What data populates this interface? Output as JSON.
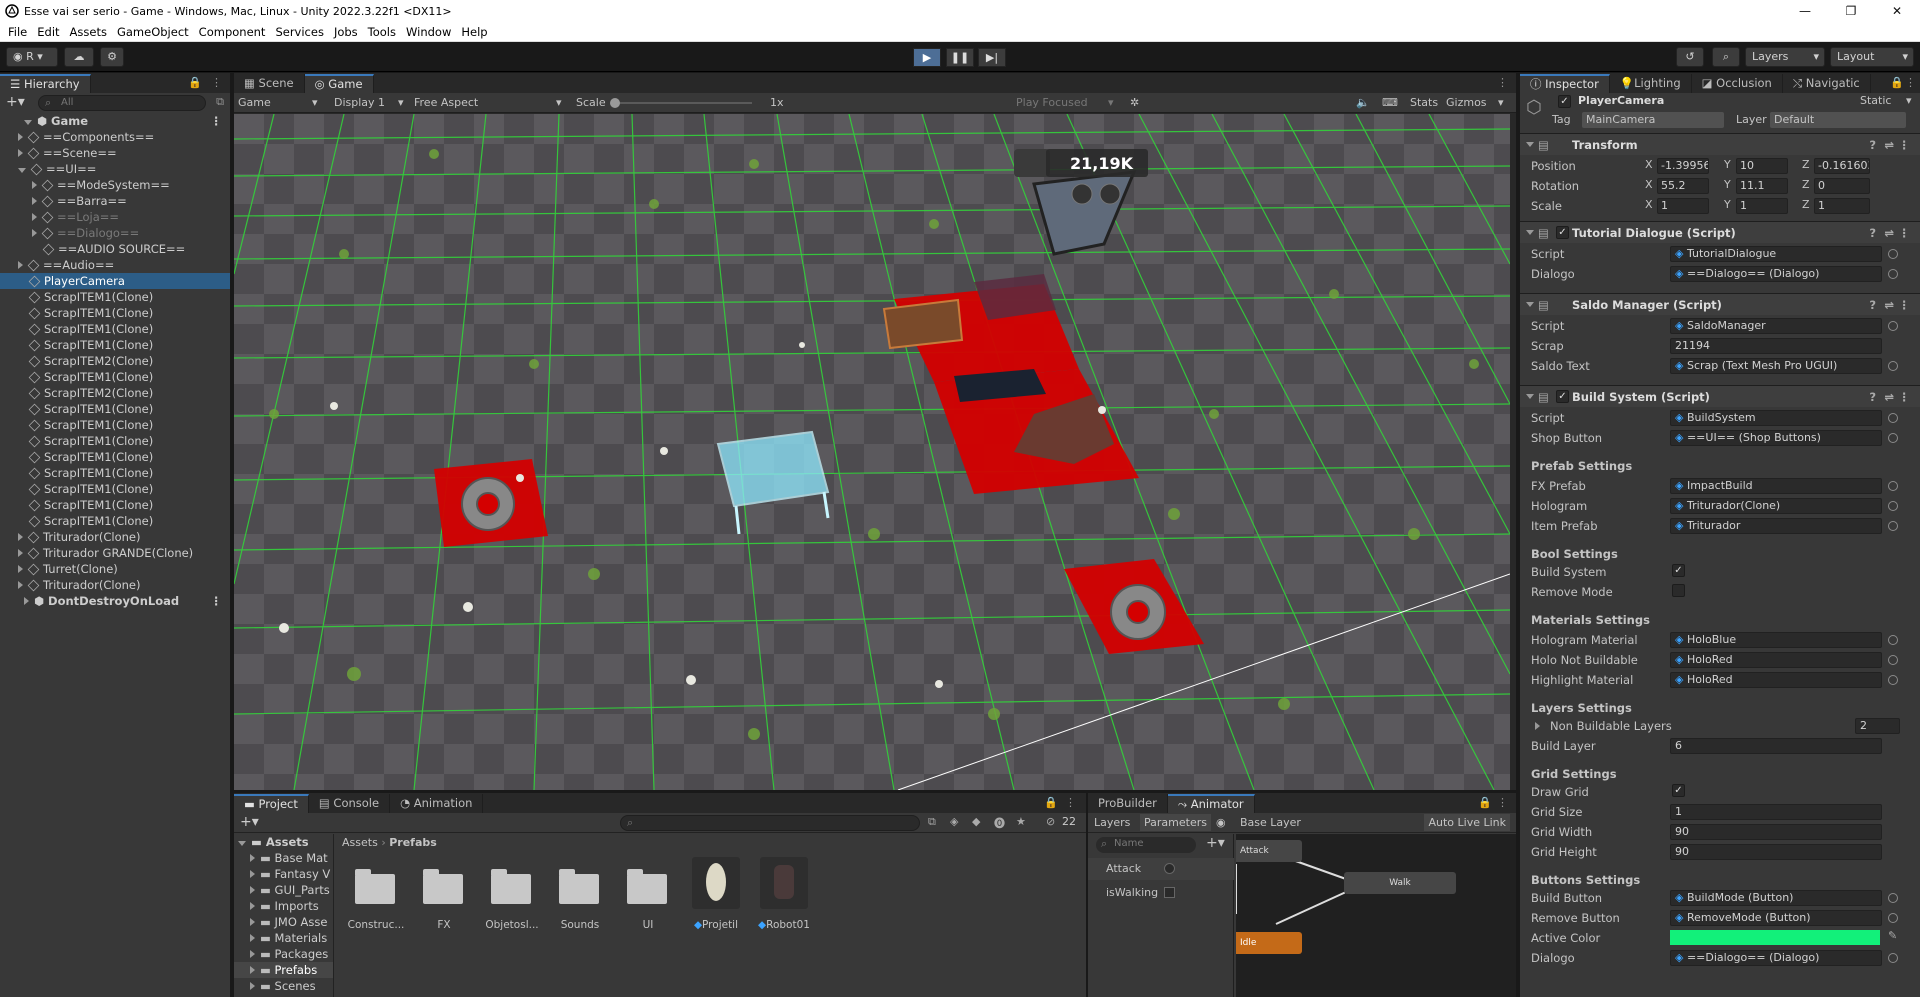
{
  "window": {
    "title": "Esse vai ser serio - Game - Windows, Mac, Linux - Unity 2022.3.22f1 <DX11>",
    "min": "—",
    "max": "❐",
    "close": "✕"
  },
  "menu": [
    "File",
    "Edit",
    "Assets",
    "GameObject",
    "Component",
    "Services",
    "Jobs",
    "Tools",
    "Window",
    "Help"
  ],
  "toolbar": {
    "account": "R",
    "layers": "Layers",
    "layout": "Layout"
  },
  "hierarchy": {
    "tab": "Hierarchy",
    "search_placeholder": "All",
    "items": [
      {
        "label": "Game",
        "depth": 0,
        "type": "scene",
        "expanded": true
      },
      {
        "label": "==Components==",
        "depth": 1,
        "arrow": true
      },
      {
        "label": "==Scene==",
        "depth": 1,
        "arrow": true
      },
      {
        "label": "==UI==",
        "depth": 1,
        "arrow": true,
        "expanded": true
      },
      {
        "label": "==ModeSystem==",
        "depth": 2,
        "arrow": true
      },
      {
        "label": "==Barra==",
        "depth": 2,
        "arrow": true
      },
      {
        "label": "==Loja==",
        "depth": 2,
        "arrow": true,
        "dim": true
      },
      {
        "label": "==Dialogo==",
        "depth": 2,
        "arrow": true,
        "dim": true
      },
      {
        "label": "==AUDIO SOURCE==",
        "depth": 2
      },
      {
        "label": "==Audio==",
        "depth": 1,
        "arrow": true
      },
      {
        "label": "PlayerCamera",
        "depth": 1,
        "selected": true
      },
      {
        "label": "ScrapITEM1(Clone)",
        "depth": 1
      },
      {
        "label": "ScrapITEM1(Clone)",
        "depth": 1
      },
      {
        "label": "ScrapITEM1(Clone)",
        "depth": 1
      },
      {
        "label": "ScrapITEM1(Clone)",
        "depth": 1
      },
      {
        "label": "ScrapITEM2(Clone)",
        "depth": 1
      },
      {
        "label": "ScrapITEM1(Clone)",
        "depth": 1
      },
      {
        "label": "ScrapITEM2(Clone)",
        "depth": 1
      },
      {
        "label": "ScrapITEM1(Clone)",
        "depth": 1
      },
      {
        "label": "ScrapITEM1(Clone)",
        "depth": 1
      },
      {
        "label": "ScrapITEM1(Clone)",
        "depth": 1
      },
      {
        "label": "ScrapITEM1(Clone)",
        "depth": 1
      },
      {
        "label": "ScrapITEM1(Clone)",
        "depth": 1
      },
      {
        "label": "ScrapITEM1(Clone)",
        "depth": 1
      },
      {
        "label": "ScrapITEM1(Clone)",
        "depth": 1
      },
      {
        "label": "ScrapITEM1(Clone)",
        "depth": 1
      },
      {
        "label": "Triturador(Clone)",
        "depth": 1,
        "arrow": true
      },
      {
        "label": "Triturador GRANDE(Clone)",
        "depth": 1,
        "arrow": true
      },
      {
        "label": "Turret(Clone)",
        "depth": 1,
        "arrow": true
      },
      {
        "label": "Triturador(Clone)",
        "depth": 1,
        "arrow": true
      },
      {
        "label": "DontDestroyOnLoad",
        "depth": 0,
        "type": "scene",
        "arrow": true
      }
    ]
  },
  "scene_tabs": {
    "scene": "Scene",
    "game": "Game"
  },
  "game_bar": {
    "mode": "Game",
    "display": "Display 1",
    "aspect": "Free Aspect",
    "scale_label": "Scale",
    "scale_value": "1x",
    "play_focused": "Play Focused",
    "stats": "Stats",
    "gizmos": "Gizmos"
  },
  "hud": {
    "scrap": "21,19K"
  },
  "inspector": {
    "tabs": [
      "Inspector",
      "Lighting",
      "Occlusion",
      "Navigatic"
    ],
    "object_name": "PlayerCamera",
    "static": "Static",
    "tag_label": "Tag",
    "tag": "MainCamera",
    "layer_label": "Layer",
    "layer": "Default",
    "transform": {
      "title": "Transform",
      "rows": [
        {
          "label": "Position",
          "x": "-1.399563",
          "y": "10",
          "z": "-0.161603"
        },
        {
          "label": "Rotation",
          "x": "55.2",
          "y": "11.1",
          "z": "0"
        },
        {
          "label": "Scale",
          "x": "1",
          "y": "1",
          "z": "1"
        }
      ]
    },
    "tutorial": {
      "title": "Tutorial Dialogue (Script)",
      "script_label": "Script",
      "script": "TutorialDialogue",
      "dialogo_label": "Dialogo",
      "dialogo": "==Dialogo== (Dialogo)"
    },
    "saldo": {
      "title": "Saldo Manager (Script)",
      "script_label": "Script",
      "script": "SaldoManager",
      "scrap_label": "Scrap",
      "scrap": "21194",
      "text_label": "Saldo Text",
      "text": "Scrap (Text Mesh Pro UGUI)"
    },
    "build": {
      "title": "Build System (Script)",
      "script_label": "Script",
      "script": "BuildSystem",
      "shop_label": "Shop Button",
      "shop": "==UI== (Shop Buttons)",
      "prefab_title": "Prefab Settings",
      "fx_label": "FX Prefab",
      "fx": "ImpactBuild",
      "holo_label": "Hologram",
      "holo": "Triturador(Clone)",
      "item_label": "Item Prefab",
      "item": "Triturador",
      "bool_title": "Bool Settings",
      "buildsys_label": "Build System",
      "remove_label": "Remove Mode",
      "mat_title": "Materials Settings",
      "hm_label": "Hologram Material",
      "hm": "HoloBlue",
      "hnb_label": "Holo Not Buildable",
      "hnb": "HoloRed",
      "hl_label": "Highlight Material",
      "hl": "HoloRed",
      "layers_title": "Layers Settings",
      "nbl_label": "Non Buildable Layers",
      "nbl": "2",
      "bl_label": "Build Layer",
      "bl": "6",
      "grid_title": "Grid Settings",
      "draw_label": "Draw Grid",
      "size_label": "Grid Size",
      "size": "1",
      "width_label": "Grid Width",
      "width": "90",
      "height_label": "Grid Height",
      "height": "90",
      "btn_title": "Buttons Settings",
      "bb_label": "Build Button",
      "bb": "BuildMode (Button)",
      "rb_label": "Remove Button",
      "rb": "RemoveMode (Button)",
      "ac_label": "Active Color",
      "dlg_label": "Dialogo",
      "dlg": "==Dialogo== (Dialogo)"
    },
    "colors": {
      "active": "#12f07a"
    }
  },
  "project": {
    "tabs": [
      "Project",
      "Console",
      "Animation"
    ],
    "count": "22",
    "tree_root": "Assets",
    "tree": [
      "Base Mat",
      "Fantasy V",
      "GUI_Parts",
      "Imports",
      "JMO Asse",
      "Materials",
      "Packages",
      "Prefabs",
      "Scenes"
    ],
    "breadcrumb": [
      "Assets",
      "Prefabs"
    ],
    "items": [
      "Construc...",
      "FX",
      "Objetosl...",
      "Sounds",
      "UI",
      "Projetil",
      "Robot01"
    ]
  },
  "animator": {
    "tabs": [
      "ProBuilder",
      "Animator"
    ],
    "layers_tab": "Layers",
    "params_tab": "Parameters",
    "base_layer": "Base Layer",
    "auto_live": "Auto Live Link",
    "search": "Name",
    "params": [
      "Attack",
      "isWalking"
    ],
    "states": [
      "Attack",
      "Walk",
      "Idle"
    ]
  }
}
